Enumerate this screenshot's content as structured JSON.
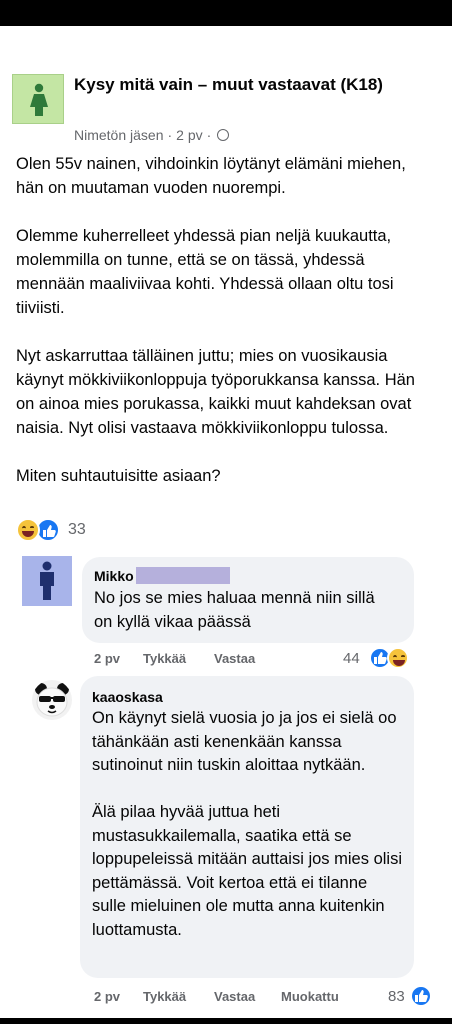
{
  "group": {
    "name": "Kysy mitä vain – muut vastaavat (K18)",
    "author": "Nimetön jäsen",
    "time": "2 pv",
    "privacy_icon": "group-icon"
  },
  "post": {
    "paragraphs": [
      "Olen 55v nainen, vihdoinkin löytänyt elämäni miehen, hän on muutaman vuoden nuorempi.",
      "Olemme kuherrelleet yhdessä pian neljä kuukautta, molemmilla on tunne, että se on tässä, yhdessä mennään maaliviivaa kohti. Yhdessä ollaan oltu tosi tiiviisti.",
      "Nyt askarruttaa tälläinen juttu; mies on vuosikausia käynyt mökkiviikonloppuja työporukkansa kanssa. Hän on ainoa mies porukassa, kaikki muut kahdeksan ovat naisia. Nyt olisi vastaava mökkiviikonloppu tulossa.",
      "Miten suhtautuisitte asiaan?"
    ],
    "reaction_count": "33",
    "reaction_icons": [
      "haha-icon",
      "like-icon"
    ]
  },
  "comments": [
    {
      "author": "Mikko",
      "text": "No jos se mies haluaa mennä niin sillä on kyllä vikaa päässä",
      "time": "2 pv",
      "like_label": "Tykkää",
      "reply_label": "Vastaa",
      "reaction_count": "44"
    },
    {
      "author": "kaaoskasa",
      "paragraphs": [
        "On käynyt sielä vuosia jo ja jos ei sielä oo tähänkään asti kenenkään kanssa sutinoinut niin tuskin aloittaa nytkään.",
        "Älä pilaa hyvää juttua heti mustasukkailemalla, saatika että se loppupeleissä mitään auttaisi jos mies olisi pettämässä. Voit kertoa että ei tilanne sulle mieluinen ole mutta anna kuitenkin luottamusta."
      ],
      "time": "2 pv",
      "like_label": "Tykkää",
      "reply_label": "Vastaa",
      "edit_label": "Muokattu",
      "reaction_count": "83"
    }
  ],
  "colors": {
    "like_blue": "#1877f2",
    "bubble_bg": "#f0f2f5",
    "meta_gray": "#65676b",
    "group_avatar_bg": "#c4e6a4",
    "user_avatar_bg": "#a8b4ea"
  }
}
